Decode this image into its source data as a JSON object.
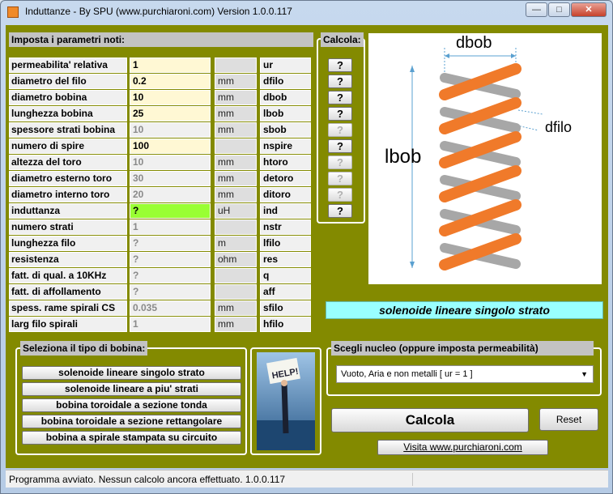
{
  "window": {
    "title": "Induttanze - By SPU (www.purchiaroni.com) Version 1.0.0.117"
  },
  "params_header": "Imposta i parametri noti:",
  "calc_header": "Calcola:",
  "rows": [
    {
      "label": "permeabilita' relativa",
      "value": "1",
      "unit": "",
      "symbol": "ur",
      "q": "?"
    },
    {
      "label": "diametro del filo",
      "value": "0.2",
      "unit": "mm",
      "symbol": "dfilo",
      "q": "?"
    },
    {
      "label": "diametro bobina",
      "value": "10",
      "unit": "mm",
      "symbol": "dbob",
      "q": "?"
    },
    {
      "label": "lunghezza bobina",
      "value": "25",
      "unit": "mm",
      "symbol": "lbob",
      "q": "?"
    },
    {
      "label": "spessore strati bobina",
      "value": "10",
      "unit": "mm",
      "symbol": "sbob",
      "q": "?"
    },
    {
      "label": "numero di spire",
      "value": "100",
      "unit": "",
      "symbol": "nspire",
      "q": "?"
    },
    {
      "label": "altezza del toro",
      "value": "10",
      "unit": "mm",
      "symbol": "htoro",
      "q": "?"
    },
    {
      "label": "diametro esterno toro",
      "value": "30",
      "unit": "mm",
      "symbol": "detoro",
      "q": "?"
    },
    {
      "label": "diametro interno toro",
      "value": "20",
      "unit": "mm",
      "symbol": "ditoro",
      "q": "?"
    },
    {
      "label": "induttanza",
      "value": "?",
      "unit": "uH",
      "symbol": "ind",
      "q": "?"
    },
    {
      "label": "numero strati",
      "value": "1",
      "unit": "",
      "symbol": "nstr"
    },
    {
      "label": "lunghezza filo",
      "value": "?",
      "unit": "m",
      "symbol": "lfilo"
    },
    {
      "label": "resistenza",
      "value": "?",
      "unit": "ohm",
      "symbol": "res"
    },
    {
      "label": "fatt. di qual. a 10KHz",
      "value": "?",
      "unit": "",
      "symbol": "q"
    },
    {
      "label": "fatt. di affollamento",
      "value": "?",
      "unit": "",
      "symbol": "aff"
    },
    {
      "label": "spess. rame spirali CS",
      "value": "0.035",
      "unit": "mm",
      "symbol": "sfilo"
    },
    {
      "label": "larg filo spirali",
      "value": "1",
      "unit": "mm",
      "symbol": "hfilo"
    }
  ],
  "diagram": {
    "top_label": "dbob",
    "side_label": "dfilo",
    "left_label": "lbob"
  },
  "solenoid_banner": "solenoide lineare singolo strato",
  "type_header": "Seleziona il tipo di bobina:",
  "type_buttons": [
    "solenoide lineare singolo strato",
    "solenoide lineare a piu' strati",
    "bobina toroidale a sezione tonda",
    "bobina toroidale a sezione rettangolare",
    "bobina a spirale stampata su circuito"
  ],
  "help_sign": "HELP!",
  "core_header": "Scegli nucleo (oppure imposta permeabilità)",
  "core_select": "Vuoto, Aria e non metalli [ ur = 1 ]",
  "calcola_button": "Calcola",
  "reset_button": "Reset",
  "visit_button": "Visita www.purchiaroni.com",
  "status": "Programma avviato. Nessun calcolo ancora effettuato. 1.0.0.117",
  "colors": {
    "background": "#838a00",
    "input": "#fff8d4",
    "highlight": "#99ff33",
    "banner": "#99ffff",
    "coil": "#f07a2a"
  }
}
